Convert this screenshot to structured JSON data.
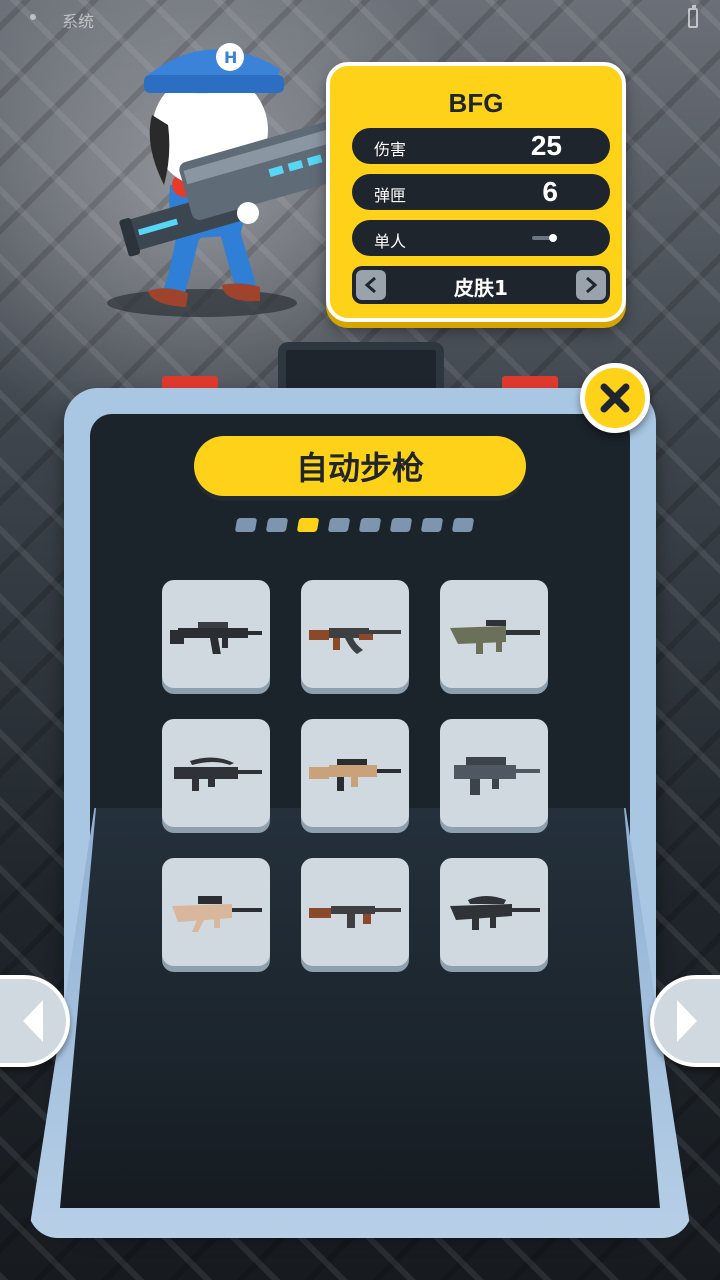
{
  "status_bar": {
    "title": "系统"
  },
  "weapon": {
    "name": "BFG",
    "stats": [
      {
        "label": "伤害",
        "value": "25"
      },
      {
        "label": "弹匣",
        "value": "6"
      },
      {
        "label": "单人",
        "mode_icon": "single-fire-icon"
      }
    ],
    "skin": "皮肤1"
  },
  "category": {
    "title": "自动步枪"
  },
  "pagination": {
    "total": 8,
    "active_index": 2
  },
  "weapon_tiles": [
    {
      "icon": "smg-black-icon"
    },
    {
      "icon": "ak-wood-icon"
    },
    {
      "icon": "bullpup-olive-icon"
    },
    {
      "icon": "famas-black-icon"
    },
    {
      "icon": "scar-tan-icon"
    },
    {
      "icon": "groza-grey-icon"
    },
    {
      "icon": "tavor-tan-icon"
    },
    {
      "icon": "tommy-gun-icon"
    },
    {
      "icon": "qbz-black-icon"
    }
  ],
  "colors": {
    "accent": "#ffd21a",
    "panel_dark": "#1e252d",
    "case_blue": "#a9c6e3",
    "latch_red": "#e03a2e"
  }
}
